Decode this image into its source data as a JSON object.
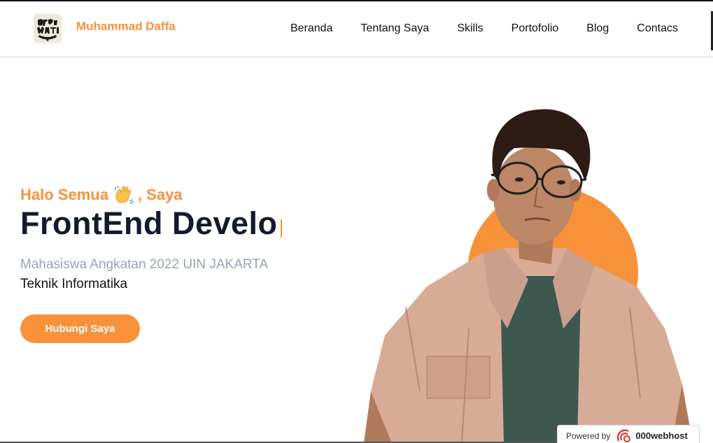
{
  "header": {
    "brand_name": "Muhammad Daffa",
    "nav": [
      "Beranda",
      "Tentang Saya",
      "Skills",
      "Portofolio",
      "Blog",
      "Contacs"
    ]
  },
  "hero": {
    "greeting_prefix": "Halo Semua",
    "greeting_suffix": ", Saya",
    "headline": "FrontEnd Develo",
    "subtitle": "Mahasiswa Angkatan 2022 UIN JAKARTA",
    "subtitle2": "Teknik Informatika",
    "cta_label": "Hubungi Saya"
  },
  "footer_badge": {
    "powered_label": "Powered by",
    "host_name": "000webhost"
  },
  "colors": {
    "accent": "#f7923a",
    "headline": "#141a2e",
    "muted": "#98a2b8"
  }
}
